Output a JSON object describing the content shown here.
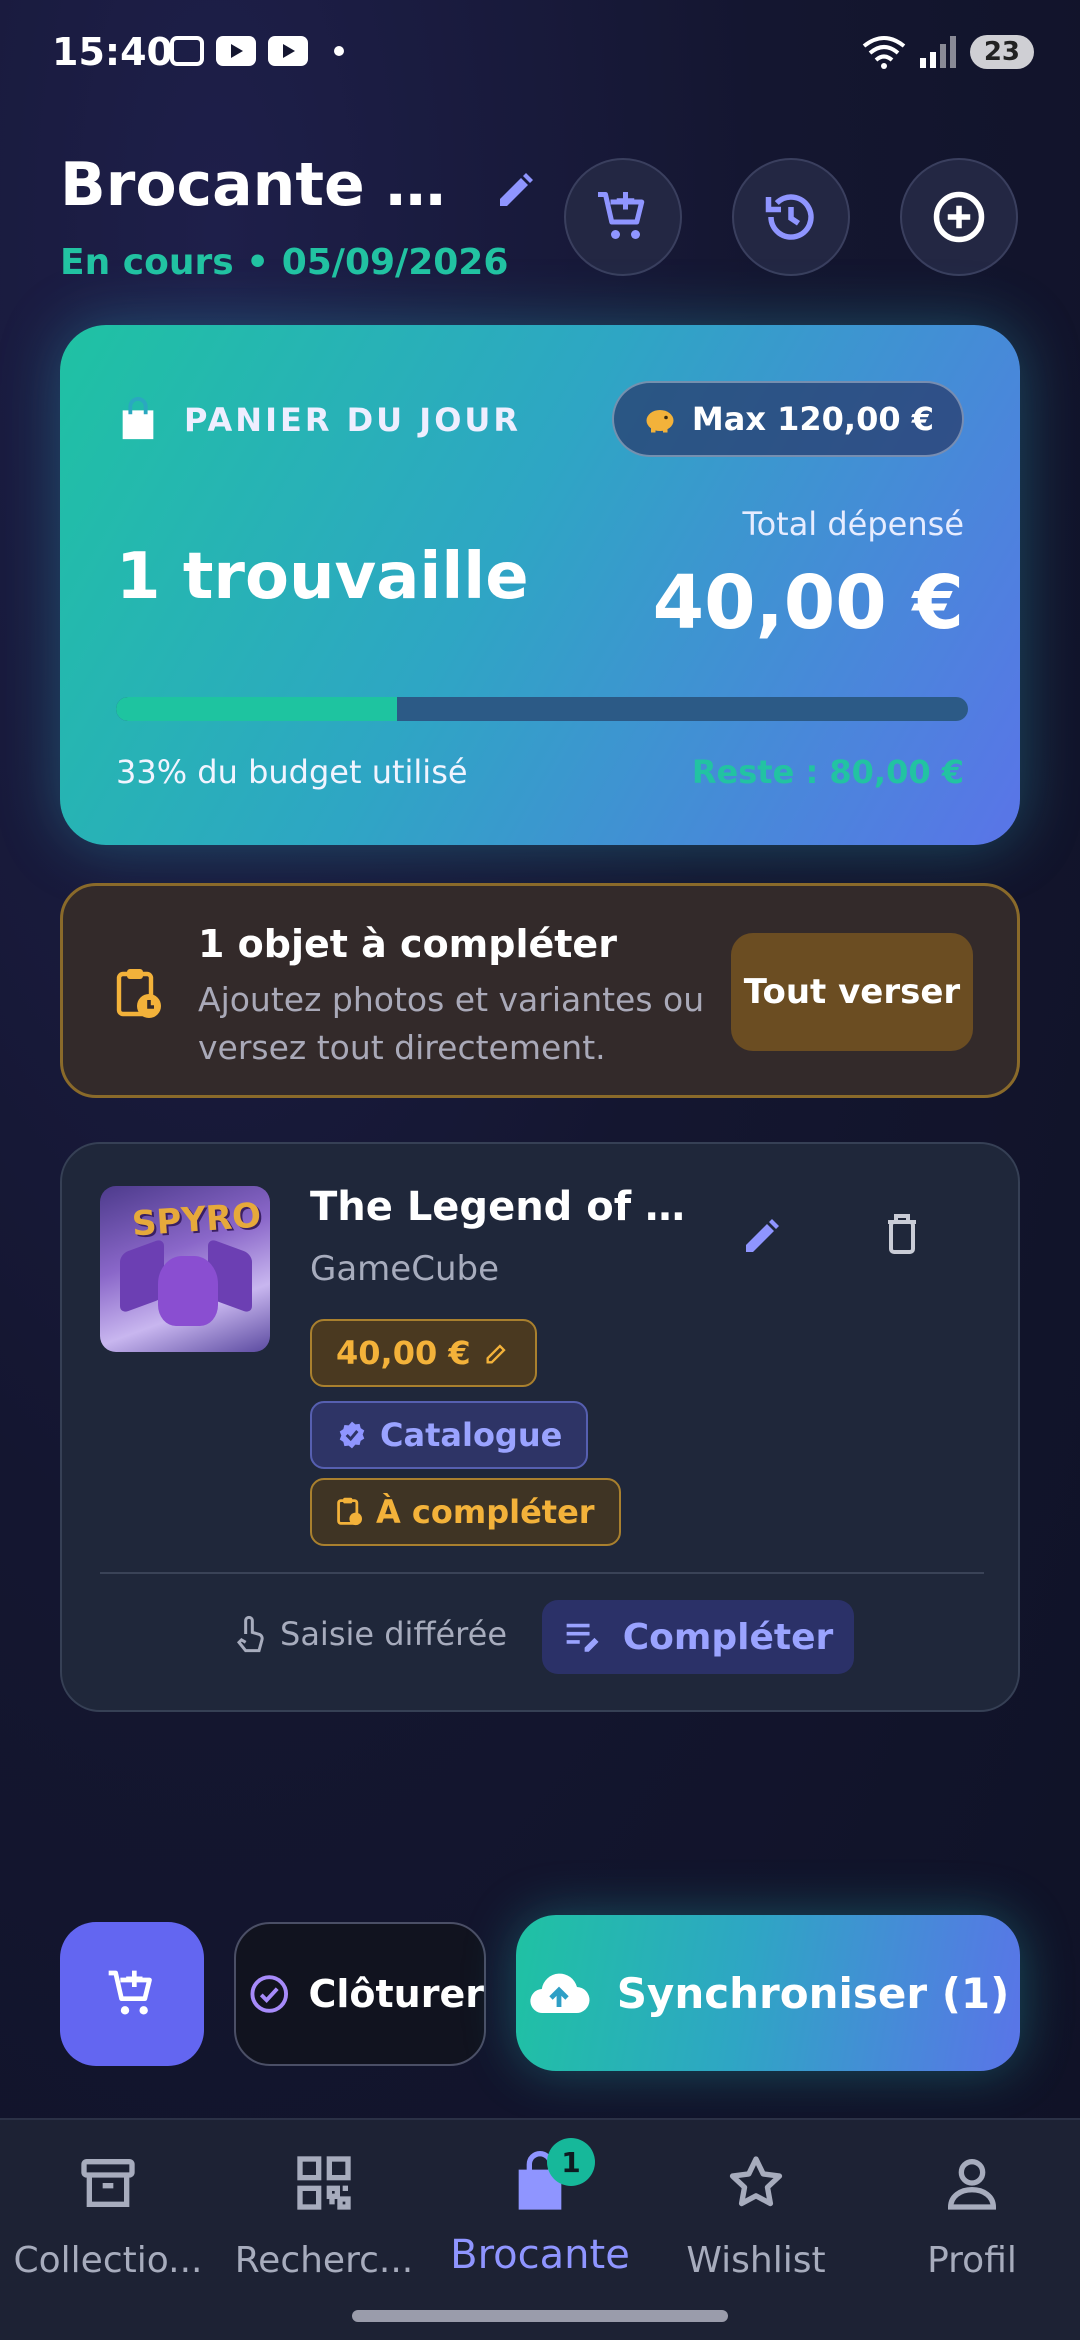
{
  "status_bar": {
    "time": "15:40",
    "battery": "23",
    "icons": [
      "screenshot-icon",
      "youtube-icon",
      "youtube-icon",
      "notification-dot",
      "wifi-icon",
      "signal-icon",
      "battery-icon"
    ]
  },
  "header": {
    "title": "Brocante d...",
    "subtitle": "En cours • 05/09/2026",
    "actions": [
      "add-to-cart-icon",
      "history-icon",
      "add-circle-icon"
    ]
  },
  "basket": {
    "label": "PANIER DU JOUR",
    "max_budget": "Max 120,00 €",
    "finds": "1 trouvaille",
    "total_label": "Total dépensé",
    "total_value": "40,00 €",
    "budget_used_fraction": 0.33,
    "budget_used_text": "33% du budget utilisé",
    "remaining_text": "Reste : 80,00 €",
    "accent_colors": {
      "teal": "#1fc2a3",
      "indigo": "#5a74e8"
    }
  },
  "warning": {
    "title": "1 objet à compléter",
    "description": "Ajoutez photos et variantes ou versez tout directement.",
    "button": "Tout verser",
    "color": "#f3b23a"
  },
  "item": {
    "thumb_text": "SPYRO",
    "name": "The Legend of S...",
    "platform": "GameCube",
    "price_chip": "40,00 €",
    "catalog_chip": "Catalogue",
    "status_chip": "À compléter",
    "deferred_label": "Saisie différée",
    "complete_button": "Compléter"
  },
  "actions": {
    "close_label": "Clôturer",
    "sync_label": "Synchroniser (1)"
  },
  "nav": {
    "items": [
      {
        "label": "Collectio...",
        "icon": "archive-icon"
      },
      {
        "label": "Recherc...",
        "icon": "qr-code-icon"
      },
      {
        "label": "Brocante",
        "icon": "shopping-bag-icon",
        "badge": "1",
        "active": true
      },
      {
        "label": "Wishlist",
        "icon": "star-icon"
      },
      {
        "label": "Profil",
        "icon": "person-icon"
      }
    ]
  }
}
